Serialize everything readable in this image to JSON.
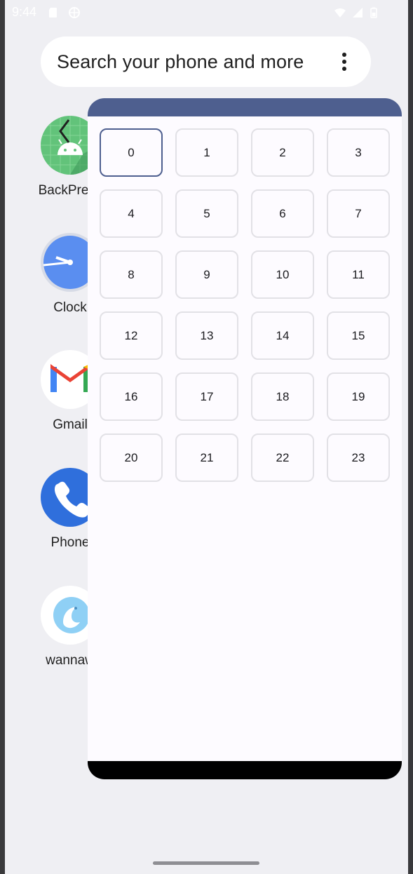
{
  "status_bar": {
    "time": "9:44",
    "left_icons": [
      "sd-card-icon",
      "vpn-icon"
    ],
    "right_icons": [
      "wifi-icon",
      "signal-icon",
      "battery-icon"
    ]
  },
  "search": {
    "placeholder": "Search your phone and more",
    "menu_icon": "more-vert-icon"
  },
  "apps": [
    {
      "label": "BackPress",
      "icon": "android-icon"
    },
    {
      "label": "Clock",
      "icon": "clock-icon"
    },
    {
      "label": "Gmail",
      "icon": "gmail-icon"
    },
    {
      "label": "Phone",
      "icon": "phone-icon"
    },
    {
      "label": "wannaw",
      "icon": "bird-icon"
    }
  ],
  "picker": {
    "selected": "0",
    "items": [
      "0",
      "1",
      "2",
      "3",
      "4",
      "5",
      "6",
      "7",
      "8",
      "9",
      "10",
      "11",
      "12",
      "13",
      "14",
      "15",
      "16",
      "17",
      "18",
      "19",
      "20",
      "21",
      "22",
      "23"
    ]
  },
  "colors": {
    "accent": "#4e5f8f",
    "background": "#efeff3",
    "panel": "#fdfbff"
  }
}
